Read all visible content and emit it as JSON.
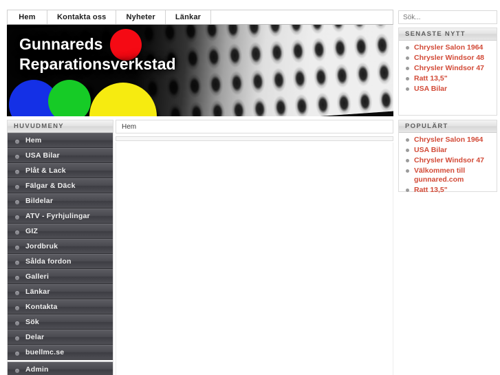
{
  "topnav": {
    "tabs": [
      {
        "label": "Hem"
      },
      {
        "label": "Kontakta oss"
      },
      {
        "label": "Nyheter"
      },
      {
        "label": "Länkar"
      }
    ]
  },
  "banner": {
    "title": "Gunnareds\nReparationsverkstad",
    "blobs": [
      {
        "name": "red-circle",
        "color": "#f50a14"
      },
      {
        "name": "blue-circle",
        "color": "#1430e6"
      },
      {
        "name": "green-circle",
        "color": "#16cb26"
      },
      {
        "name": "yellow-circle",
        "color": "#f6eb10"
      }
    ]
  },
  "search": {
    "placeholder": "Sök...",
    "value": ""
  },
  "senaste": {
    "header": "SENASTE NYTT",
    "items": [
      {
        "label": "Chrysler Salon 1964"
      },
      {
        "label": "Chrysler Windsor 48"
      },
      {
        "label": "Chrysler Windsor 47"
      },
      {
        "label": "Ratt 13,5\""
      },
      {
        "label": "USA Bilar"
      }
    ]
  },
  "popular": {
    "header": "POPULÄRT",
    "items": [
      {
        "label": "Chrysler Salon 1964"
      },
      {
        "label": "USA Bilar"
      },
      {
        "label": "Chrysler Windsor 47"
      },
      {
        "label": "Välkommen till gunnared.com"
      },
      {
        "label": "Ratt 13,5\""
      }
    ]
  },
  "menu": {
    "header": "HUVUDMENY",
    "items": [
      {
        "label": "Hem"
      },
      {
        "label": "USA Bilar"
      },
      {
        "label": "Plåt & Lack"
      },
      {
        "label": "Fälgar & Däck"
      },
      {
        "label": "Bildelar"
      },
      {
        "label": "ATV - Fyrhjulingar"
      },
      {
        "label": "GIZ"
      },
      {
        "label": "Jordbruk"
      },
      {
        "label": "Sålda fordon"
      },
      {
        "label": "Galleri"
      },
      {
        "label": "Länkar"
      },
      {
        "label": "Kontakta"
      },
      {
        "label": "Sök"
      },
      {
        "label": "Delar"
      },
      {
        "label": "buellmc.se"
      }
    ],
    "admin": {
      "label": "Admin"
    }
  },
  "content": {
    "breadcrumb": "Hem",
    "body": ""
  },
  "colors": {
    "link": "#d24a37",
    "menu_text": "#f0f0f0",
    "panel_head": "#5e5e5e"
  }
}
